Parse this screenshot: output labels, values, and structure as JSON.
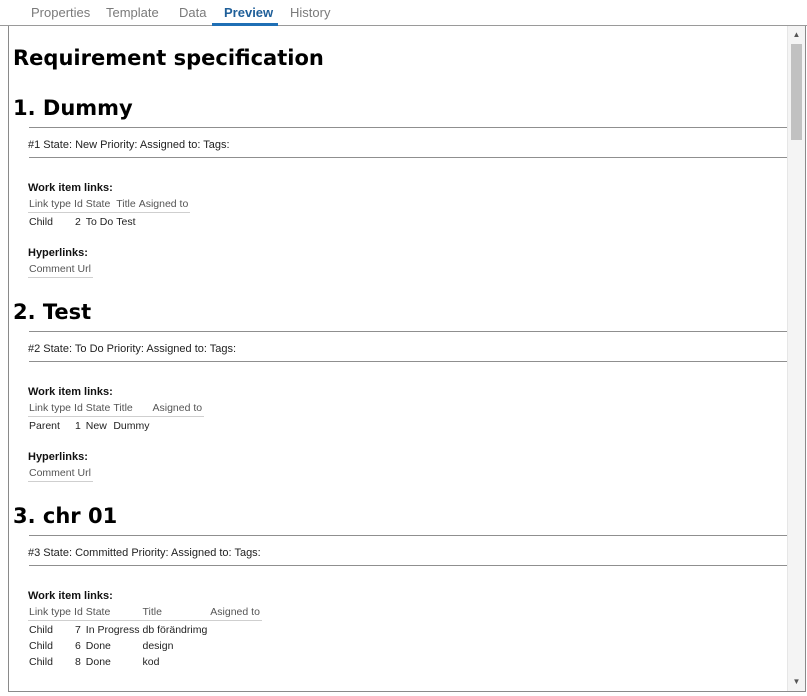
{
  "tabs": [
    {
      "label": "Properties",
      "active": false
    },
    {
      "label": "Template",
      "active": false
    },
    {
      "label": "Data",
      "active": false
    },
    {
      "label": "Preview",
      "active": true
    },
    {
      "label": "History",
      "active": false
    }
  ],
  "document": {
    "title": "Requirement specification",
    "sections": [
      {
        "heading": "1. Dummy",
        "meta": "#1 State: New Priority: Assigned to:  Tags:",
        "work_item_links_label": "Work item links:",
        "links_columns": [
          "Link type",
          "Id",
          "State",
          "Title",
          "Asigned to"
        ],
        "links_rows": [
          {
            "type": "Child",
            "id": "2",
            "state": "To Do",
            "title": "Test",
            "assigned": ""
          }
        ],
        "hyperlinks_label": "Hyperlinks:",
        "hyperlinks_columns": [
          "Comment",
          "Url"
        ]
      },
      {
        "heading": "2. Test",
        "meta": "#2 State: To Do Priority: Assigned to:  Tags:",
        "work_item_links_label": "Work item links:",
        "links_columns": [
          "Link type",
          "Id",
          "State",
          "Title",
          "Asigned to"
        ],
        "links_rows": [
          {
            "type": "Parent",
            "id": "1",
            "state": "New",
            "title": "Dummy",
            "assigned": ""
          }
        ],
        "hyperlinks_label": "Hyperlinks:",
        "hyperlinks_columns": [
          "Comment",
          "Url"
        ]
      },
      {
        "heading": "3. chr 01",
        "meta": "#3 State: Committed Priority: Assigned to:  Tags:",
        "work_item_links_label": "Work item links:",
        "links_columns": [
          "Link type",
          "Id",
          "State",
          "Title",
          "Asigned to"
        ],
        "links_rows": [
          {
            "type": "Child",
            "id": "7",
            "state": "In Progress",
            "title": "db förändrimg",
            "assigned": ""
          },
          {
            "type": "Child",
            "id": "6",
            "state": "Done",
            "title": "design",
            "assigned": ""
          },
          {
            "type": "Child",
            "id": "8",
            "state": "Done",
            "title": "kod",
            "assigned": ""
          }
        ]
      }
    ]
  },
  "colors": {
    "accent": "#1f6fb5",
    "tab_inactive": "#7a7a7a",
    "rule": "#8f8f8f"
  },
  "icons": {
    "scroll_up": "triangle-up-icon",
    "scroll_down": "triangle-down-icon"
  }
}
